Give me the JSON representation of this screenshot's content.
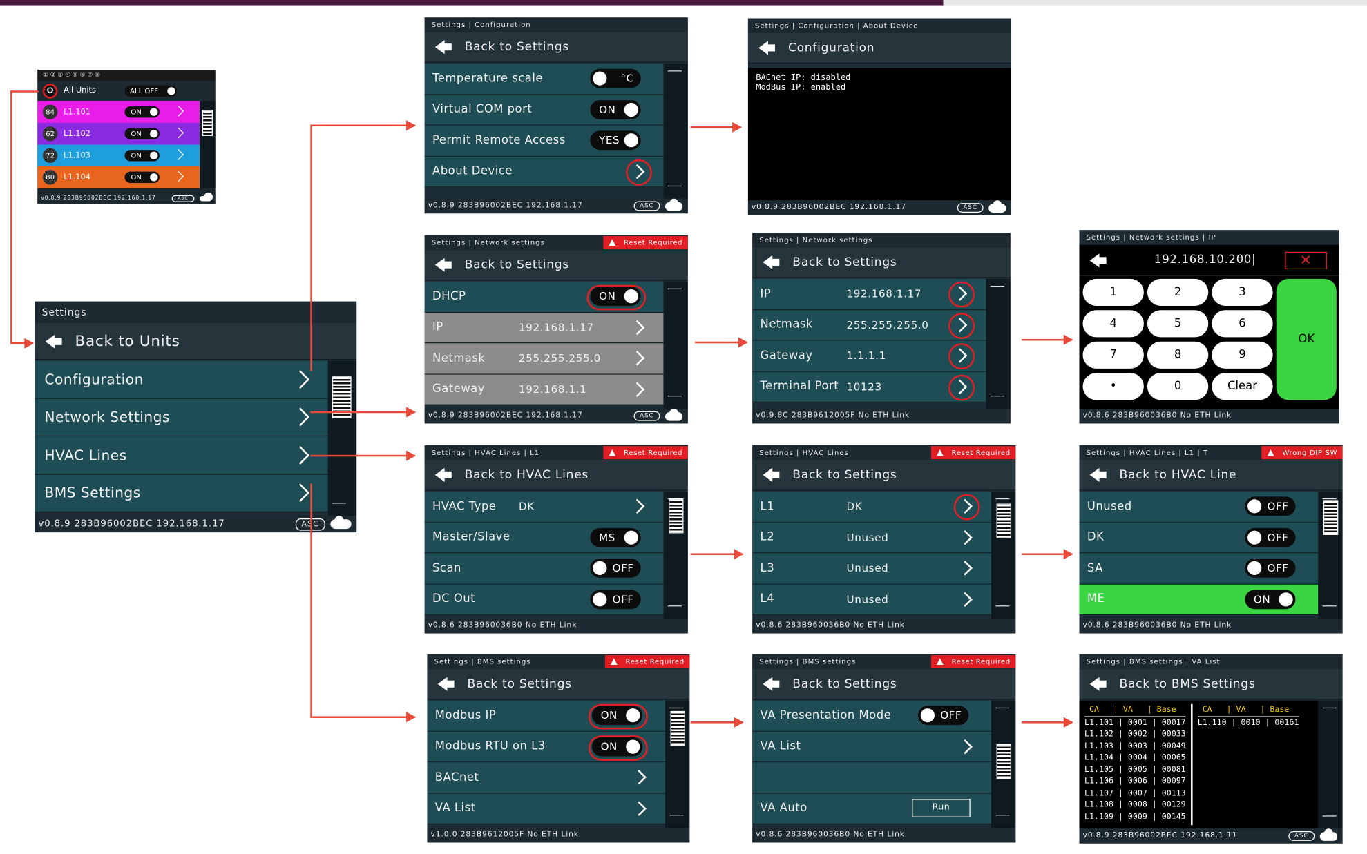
{
  "units": {
    "tabs": "① ② ③  ④ ⑤ ⑥ ⑦ ⑧",
    "all_units": "All Units",
    "all_off": "ALL OFF",
    "rows": [
      {
        "num": "84",
        "name": "L1.101",
        "state": "ON",
        "color": "#e81ee8"
      },
      {
        "num": "62",
        "name": "L1.102",
        "state": "ON",
        "color": "#8a2be2"
      },
      {
        "num": "72",
        "name": "L1.103",
        "state": "ON",
        "color": "#1e9edc"
      },
      {
        "num": "80",
        "name": "L1.104",
        "state": "ON",
        "color": "#e8651e"
      }
    ],
    "footer": "v0.8.9  283B96002BEC  192.168.1.17"
  },
  "settings": {
    "header": "Settings",
    "back": "Back to Units",
    "items": [
      "Configuration",
      "Network Settings",
      "HVAC Lines",
      "BMS Settings"
    ],
    "footer": "v0.8.9  283B96002BEC  192.168.1.17",
    "asc": "ASC"
  },
  "config": {
    "header": "Settings | Configuration",
    "back": "Back to Settings",
    "rows": [
      {
        "label": "Temperature scale",
        "toggle": "°C"
      },
      {
        "label": "Virtual COM port",
        "toggle": "ON"
      },
      {
        "label": "Permit Remote Access",
        "toggle": "YES"
      },
      {
        "label": "About Device"
      }
    ],
    "footer": "v0.8.9  283B96002BEC  192.168.1.17"
  },
  "about": {
    "header": "Settings | Configuration | About Device",
    "back": "Configuration",
    "text": "BACnet IP: disabled\nModBus IP: enabled",
    "footer": "v0.8.9  283B96002BEC  192.168.1.17"
  },
  "net1": {
    "header": "Settings | Network settings",
    "reset": "Reset Required",
    "back": "Back to Settings",
    "rows": [
      {
        "label": "DHCP",
        "toggle": "ON"
      },
      {
        "label": "IP",
        "value": "192.168.1.17"
      },
      {
        "label": "Netmask",
        "value": "255.255.255.0"
      },
      {
        "label": "Gateway",
        "value": "192.168.1.1"
      }
    ],
    "footer": "v0.8.9  283B96002BEC  192.168.1.17"
  },
  "net2": {
    "header": "Settings | Network settings",
    "back": "Back to Settings",
    "rows": [
      {
        "label": "IP",
        "value": "192.168.1.17"
      },
      {
        "label": "Netmask",
        "value": "255.255.255.0"
      },
      {
        "label": "Gateway",
        "value": "1.1.1.1"
      },
      {
        "label": "Terminal Port",
        "value": "10123"
      }
    ],
    "footer": "v0.9.8C  283B9612005F  No ETH Link"
  },
  "keypad": {
    "header": "Settings | Network settings | IP",
    "value": "192.168.10.200|",
    "keys": [
      "1",
      "2",
      "3",
      "4",
      "5",
      "6",
      "7",
      "8",
      "9",
      "•",
      "0",
      "Clear"
    ],
    "ok": "OK",
    "footer": "v0.8.6  283B960036B0  No ETH Link"
  },
  "hvac1": {
    "header": "Settings | HVAC Lines | L1",
    "reset": "Reset Required",
    "back": "Back to HVAC Lines",
    "rows": [
      {
        "label": "HVAC Type",
        "value": "DK"
      },
      {
        "label": "Master/Slave",
        "toggle": "MS"
      },
      {
        "label": "Scan",
        "toggle": "OFF"
      },
      {
        "label": "DC Out",
        "toggle": "OFF"
      }
    ],
    "footer": "v0.8.6  283B960036B0  No ETH Link"
  },
  "hvac2": {
    "header": "Settings | HVAC Lines",
    "reset": "Reset Required",
    "back": "Back to Settings",
    "rows": [
      {
        "label": "L1",
        "value": "DK"
      },
      {
        "label": "L2",
        "value": "Unused"
      },
      {
        "label": "L3",
        "value": "Unused"
      },
      {
        "label": "L4",
        "value": "Unused"
      }
    ],
    "footer": "v0.8.6  283B960036B0  No ETH Link"
  },
  "hvac3": {
    "header": "Settings | HVAC Lines | L1 | T",
    "reset": "Wrong DIP SW",
    "back": "Back to HVAC Line",
    "rows": [
      {
        "label": "Unused",
        "toggle": "OFF"
      },
      {
        "label": "DK",
        "toggle": "OFF"
      },
      {
        "label": "SA",
        "toggle": "OFF"
      },
      {
        "label": "ME",
        "toggle": "ON"
      }
    ],
    "footer": "v0.8.6  283B960036B0  No ETH Link"
  },
  "bms1": {
    "header": "Settings | BMS settings",
    "reset": "Reset Required",
    "back": "Back to Settings",
    "rows": [
      {
        "label": "Modbus IP",
        "toggle": "ON"
      },
      {
        "label": "Modbus RTU on L3",
        "toggle": "ON"
      },
      {
        "label": "BACnet"
      },
      {
        "label": "VA List"
      }
    ],
    "footer": "v1.0.0  283B9612005F  No ETH Link"
  },
  "bms2": {
    "header": "Settings | BMS settings",
    "reset": "Reset Required",
    "back": "Back to Settings",
    "rows": [
      {
        "label": "VA Presentation Mode",
        "toggle": "OFF"
      },
      {
        "label": "VA List"
      },
      {
        "label": ""
      },
      {
        "label": "VA Auto",
        "button": "Run"
      }
    ],
    "footer": "v0.8.6  283B960036B0  No ETH Link"
  },
  "valist": {
    "header": "Settings | BMS settings | VA List",
    "back": "Back to BMS Settings",
    "colhead": " CA   | VA   | Base",
    "left": [
      "L1.101 | 0001 | 00017",
      "L1.102 | 0002 | 00033",
      "L1.103 | 0003 | 00049",
      "L1.104 | 0004 | 00065",
      "L1.105 | 0005 | 00081",
      "L1.106 | 0006 | 00097",
      "L1.107 | 0007 | 00113",
      "L1.108 | 0008 | 00129",
      "L1.109 | 0009 | 00145"
    ],
    "right": [
      "L1.110 | 0010 | 00161"
    ],
    "footer": "v0.8.9  283B96002BEC  192.168.1.11"
  },
  "asc": "ASC"
}
